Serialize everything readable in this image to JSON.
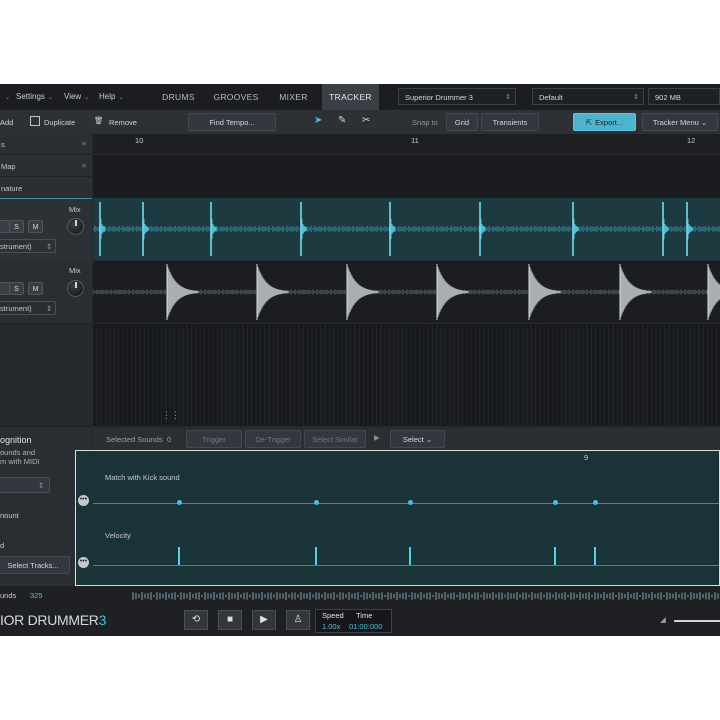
{
  "menu": {
    "settings": "Settings",
    "view": "View",
    "help": "Help"
  },
  "tabs": [
    "DRUMS",
    "GROOVES",
    "MIXER",
    "TRACKER"
  ],
  "preset": {
    "product": "Superior Drummer 3",
    "setting": "Default",
    "memory": "902 MB"
  },
  "toolbar": {
    "add": "Add",
    "duplicate": "Duplicate",
    "remove": "Remove",
    "find_tempo": "Find Tempo...",
    "snap_to": "Snap to",
    "grid": "Grid",
    "transients": "Transients",
    "export": "Export...",
    "tracker_menu": "Tracker Menu"
  },
  "ruler": {
    "marks": [
      "10",
      "11",
      "12"
    ]
  },
  "left_rows": {
    "row1": "s",
    "row2": "Map",
    "row3": "nature"
  },
  "tracks": [
    {
      "mix": "Mix",
      "s": "S",
      "m": "M",
      "instrument": "strument)"
    },
    {
      "mix": "Mix",
      "s": "S",
      "m": "M",
      "instrument": "strument)"
    }
  ],
  "recognition": {
    "title": "ognition",
    "desc_line1": "ounds and",
    "desc_line2": "m with MIDI",
    "amount": "nount",
    "d_label": "d",
    "select_tracks": "Select Tracks...",
    "sounds_label": "unds",
    "sounds_count": "325"
  },
  "sound_bar": {
    "selected_sounds": "Selected Sounds",
    "selected_count": "0",
    "trigger": "Trigger",
    "detrigger": "De-Trigger",
    "select_similar": "Select Similar",
    "select": "Select"
  },
  "detail": {
    "bar_mark": "9",
    "match_label": "Match with Kick sound",
    "velocity_label": "Velocity"
  },
  "transport": {
    "logo_main": "IOR DRUMMER",
    "logo_num": "3",
    "speed_label": "Speed",
    "speed_value": "1.00x",
    "time_label": "Time",
    "time_value": "01:00:000"
  },
  "colors": {
    "accent": "#4fb3cf",
    "waveform": "#3fb6cf",
    "panel": "#26292d"
  }
}
